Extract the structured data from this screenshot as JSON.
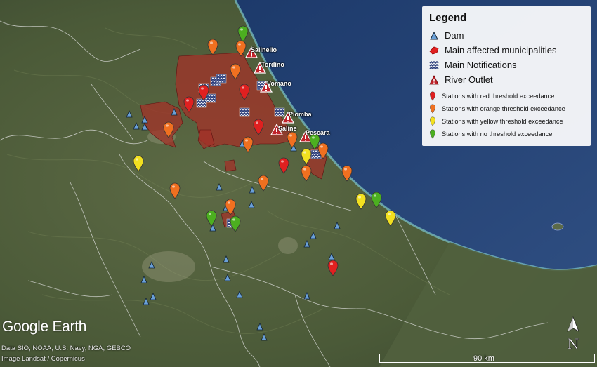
{
  "legend": {
    "title": "Legend",
    "items": [
      {
        "icon": "dam-triangle-icon",
        "label": "Dam"
      },
      {
        "icon": "red-polygon-icon",
        "label": "Main affected municipalities"
      },
      {
        "icon": "waves-icon",
        "label": "Main Notifications"
      },
      {
        "icon": "warning-triangle-icon",
        "label": "River Outlet"
      }
    ],
    "stations": [
      {
        "color": "#e02020",
        "label": "Stations with red threshold exceedance"
      },
      {
        "color": "#f07020",
        "label": "Stations with orange threshold exceedance"
      },
      {
        "color": "#f2e020",
        "label": "Stations with yellow threshold exceedance"
      },
      {
        "color": "#4caf20",
        "label": "Stations with no threshold exceedance"
      }
    ]
  },
  "rivers": [
    "Salinello",
    "Tordino",
    "Vomano",
    "Piomba",
    "Saline",
    "Pescara"
  ],
  "branding": {
    "logo": "Google Earth"
  },
  "credits": [
    "Data SIO, NOAA, U.S. Navy, NGA, GEBCO",
    "Image Landsat / Copernicus"
  ],
  "scale_label": "90 km",
  "north_label": "N",
  "colors": {
    "sea": "#2c4a78",
    "land": "#4a5a3c",
    "affected": "#a0302a"
  }
}
